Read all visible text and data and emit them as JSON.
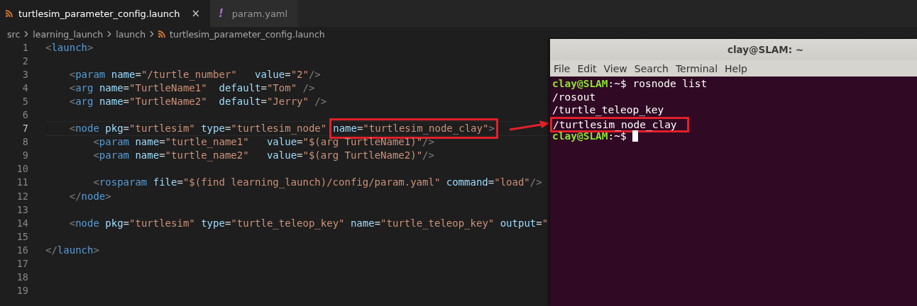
{
  "tabs": [
    {
      "label": "turtlesim_parameter_config.launch",
      "kind": "launch",
      "selected": true,
      "close": "×"
    },
    {
      "label": "param.yaml",
      "kind": "yaml",
      "selected": false,
      "mark": "!"
    }
  ],
  "breadcrumb": [
    {
      "label": "src",
      "kind": "folder"
    },
    {
      "label": "learning_launch",
      "kind": "folder"
    },
    {
      "label": "launch",
      "kind": "folder"
    },
    {
      "label": "turtlesim_parameter_config.launch",
      "kind": "file"
    }
  ],
  "code": [
    {
      "number": "1",
      "current": false,
      "segments": [
        {
          "boxed": false,
          "tokens": [
            {
              "kind": "punct",
              "text": "<"
            },
            {
              "kind": "tag",
              "text": "launch"
            },
            {
              "kind": "punct",
              "text": ">"
            }
          ]
        }
      ]
    },
    {
      "number": "2",
      "current": false
    },
    {
      "number": "3",
      "current": false,
      "segments": [
        {
          "boxed": false,
          "tokens": [
            {
              "kind": "punct",
              "text": "    <"
            },
            {
              "kind": "tag",
              "text": "param"
            },
            {
              "kind": "attr",
              "text": " name"
            },
            {
              "kind": "op",
              "text": "="
            },
            {
              "kind": "string",
              "text": "\"/turtle_number\""
            },
            {
              "kind": "attr",
              "text": "   value"
            },
            {
              "kind": "op",
              "text": "="
            },
            {
              "kind": "string",
              "text": "\"2\""
            },
            {
              "kind": "punct",
              "text": "/>"
            }
          ]
        }
      ]
    },
    {
      "number": "4",
      "current": false,
      "segments": [
        {
          "boxed": false,
          "tokens": [
            {
              "kind": "punct",
              "text": "    <"
            },
            {
              "kind": "tag",
              "text": "arg"
            },
            {
              "kind": "attr",
              "text": " name"
            },
            {
              "kind": "op",
              "text": "="
            },
            {
              "kind": "string",
              "text": "\"TurtleName1\""
            },
            {
              "kind": "attr",
              "text": "  default"
            },
            {
              "kind": "op",
              "text": "="
            },
            {
              "kind": "string",
              "text": "\"Tom\""
            },
            {
              "kind": "punct",
              "text": " />"
            }
          ]
        }
      ]
    },
    {
      "number": "5",
      "current": false,
      "segments": [
        {
          "boxed": false,
          "tokens": [
            {
              "kind": "punct",
              "text": "    <"
            },
            {
              "kind": "tag",
              "text": "arg"
            },
            {
              "kind": "attr",
              "text": " name"
            },
            {
              "kind": "op",
              "text": "="
            },
            {
              "kind": "string",
              "text": "\"TurtleName2\""
            },
            {
              "kind": "attr",
              "text": "  default"
            },
            {
              "kind": "op",
              "text": "="
            },
            {
              "kind": "string",
              "text": "\"Jerry\""
            },
            {
              "kind": "punct",
              "text": " />"
            }
          ]
        }
      ]
    },
    {
      "number": "6",
      "current": false
    },
    {
      "number": "7",
      "current": true,
      "segments": [
        {
          "boxed": false,
          "tokens": [
            {
              "kind": "punct",
              "text": "    <"
            },
            {
              "kind": "tag",
              "text": "node"
            },
            {
              "kind": "attr",
              "text": " pkg"
            },
            {
              "kind": "op",
              "text": "="
            },
            {
              "kind": "string",
              "text": "\"turtlesim\""
            },
            {
              "kind": "attr",
              "text": " type"
            },
            {
              "kind": "op",
              "text": "="
            },
            {
              "kind": "string",
              "text": "\"turtlesim_node\""
            }
          ]
        },
        {
          "boxed": true,
          "tokens": [
            {
              "kind": "attr",
              "text": "name"
            },
            {
              "kind": "op",
              "text": "="
            },
            {
              "kind": "string",
              "text": "\"turtlesim_node_clay\""
            },
            {
              "kind": "punct",
              "text": ">"
            }
          ]
        }
      ]
    },
    {
      "number": "8",
      "current": false,
      "segments": [
        {
          "boxed": false,
          "tokens": [
            {
              "kind": "punct",
              "text": "        <"
            },
            {
              "kind": "tag",
              "text": "param"
            },
            {
              "kind": "attr",
              "text": " name"
            },
            {
              "kind": "op",
              "text": "="
            },
            {
              "kind": "string",
              "text": "\"turtle_name1\""
            },
            {
              "kind": "attr",
              "text": "   value"
            },
            {
              "kind": "op",
              "text": "="
            },
            {
              "kind": "string",
              "text": "\"$(arg TurtleName1)\""
            },
            {
              "kind": "punct",
              "text": "/>"
            }
          ]
        }
      ]
    },
    {
      "number": "9",
      "current": false,
      "segments": [
        {
          "boxed": false,
          "tokens": [
            {
              "kind": "punct",
              "text": "        <"
            },
            {
              "kind": "tag",
              "text": "param"
            },
            {
              "kind": "attr",
              "text": " name"
            },
            {
              "kind": "op",
              "text": "="
            },
            {
              "kind": "string",
              "text": "\"turtle_name2\""
            },
            {
              "kind": "attr",
              "text": "   value"
            },
            {
              "kind": "op",
              "text": "="
            },
            {
              "kind": "string",
              "text": "\"$(arg TurtleName2)\""
            },
            {
              "kind": "punct",
              "text": "/>"
            }
          ]
        }
      ]
    },
    {
      "number": "10",
      "current": false
    },
    {
      "number": "11",
      "current": false,
      "segments": [
        {
          "boxed": false,
          "tokens": [
            {
              "kind": "punct",
              "text": "        <"
            },
            {
              "kind": "tag",
              "text": "rosparam"
            },
            {
              "kind": "attr",
              "text": " file"
            },
            {
              "kind": "op",
              "text": "="
            },
            {
              "kind": "string",
              "text": "\"$(find learning_launch)/config/param.yaml\""
            },
            {
              "kind": "attr",
              "text": " command"
            },
            {
              "kind": "op",
              "text": "="
            },
            {
              "kind": "string",
              "text": "\"load\""
            },
            {
              "kind": "punct",
              "text": "/>"
            }
          ]
        }
      ]
    },
    {
      "number": "12",
      "current": false,
      "segments": [
        {
          "boxed": false,
          "tokens": [
            {
              "kind": "punct",
              "text": "    </"
            },
            {
              "kind": "tag",
              "text": "node"
            },
            {
              "kind": "punct",
              "text": ">"
            }
          ]
        }
      ]
    },
    {
      "number": "13",
      "current": false
    },
    {
      "number": "14",
      "current": false,
      "segments": [
        {
          "boxed": false,
          "tokens": [
            {
              "kind": "punct",
              "text": "    <"
            },
            {
              "kind": "tag",
              "text": "node"
            },
            {
              "kind": "attr",
              "text": " pkg"
            },
            {
              "kind": "op",
              "text": "="
            },
            {
              "kind": "string",
              "text": "\"turtlesim\""
            },
            {
              "kind": "attr",
              "text": " type"
            },
            {
              "kind": "op",
              "text": "="
            },
            {
              "kind": "string",
              "text": "\"turtle_teleop_key\""
            },
            {
              "kind": "attr",
              "text": " name"
            },
            {
              "kind": "op",
              "text": "="
            },
            {
              "kind": "string",
              "text": "\"turtle_teleop_key\""
            },
            {
              "kind": "attr",
              "text": " output"
            },
            {
              "kind": "op",
              "text": "="
            },
            {
              "kind": "string",
              "text": "\""
            }
          ]
        }
      ]
    },
    {
      "number": "15",
      "current": false
    },
    {
      "number": "16",
      "current": false,
      "segments": [
        {
          "boxed": false,
          "tokens": [
            {
              "kind": "punct",
              "text": "</"
            },
            {
              "kind": "tag",
              "text": "launch"
            },
            {
              "kind": "punct",
              "text": ">"
            }
          ]
        }
      ]
    },
    {
      "number": "17",
      "current": false
    },
    {
      "number": "18",
      "current": false
    },
    {
      "number": "19",
      "current": false
    }
  ],
  "terminal": {
    "title": "clay@SLAM: ~",
    "menu": [
      "File",
      "Edit",
      "View",
      "Search",
      "Terminal",
      "Help"
    ],
    "lines": [
      {
        "kind": "prompt",
        "user": "clay@SLAM",
        "path": ":~$",
        "command": " rosnode list",
        "cursor": false
      },
      {
        "kind": "output",
        "text": "/rosout",
        "boxed": false
      },
      {
        "kind": "output",
        "text": "/turtle_teleop_key",
        "boxed": false
      },
      {
        "kind": "output",
        "text": "/turtlesim_node_clay",
        "boxed": true
      },
      {
        "kind": "prompt",
        "user": "clay@SLAM",
        "path": ":~$",
        "cursor": true
      }
    ]
  }
}
